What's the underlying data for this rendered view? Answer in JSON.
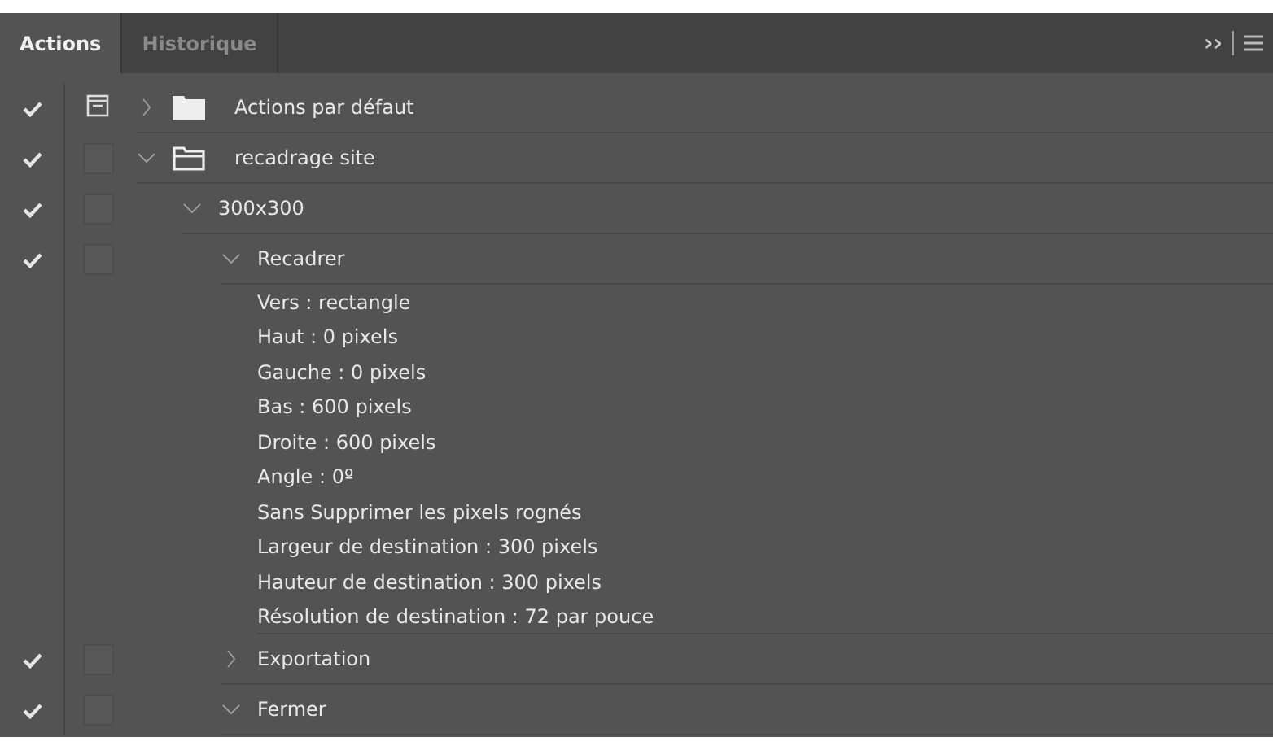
{
  "tabs": [
    {
      "label": "Actions",
      "selected": true
    },
    {
      "label": "Historique",
      "selected": false
    }
  ],
  "panel_menu": {
    "overflow": "››"
  },
  "actions": [
    {
      "kind": "set",
      "name": "Actions par défaut",
      "checked": true,
      "dialog": true,
      "expanded": false
    },
    {
      "kind": "set",
      "name": "recadrage site",
      "checked": true,
      "dialog": false,
      "expanded": true,
      "children": [
        {
          "kind": "action",
          "name": "300x300",
          "checked": true,
          "dialog": false,
          "expanded": true,
          "children": [
            {
              "kind": "command",
              "name": "Recadrer",
              "checked": true,
              "dialog": false,
              "expanded": true,
              "details": [
                "Vers : rectangle",
                "Haut : 0 pixels",
                "Gauche : 0 pixels",
                "Bas : 600 pixels",
                "Droite : 600 pixels",
                "Angle : 0º",
                "Sans Supprimer les pixels rognés",
                "Largeur de destination : 300 pixels",
                "Hauteur de destination : 300 pixels",
                "Résolution de destination : 72 par pouce"
              ]
            },
            {
              "kind": "command",
              "name": "Exportation",
              "checked": true,
              "dialog": false,
              "expanded": false
            },
            {
              "kind": "command",
              "name": "Fermer",
              "checked": true,
              "dialog": false,
              "expanded": true
            }
          ]
        }
      ]
    }
  ]
}
